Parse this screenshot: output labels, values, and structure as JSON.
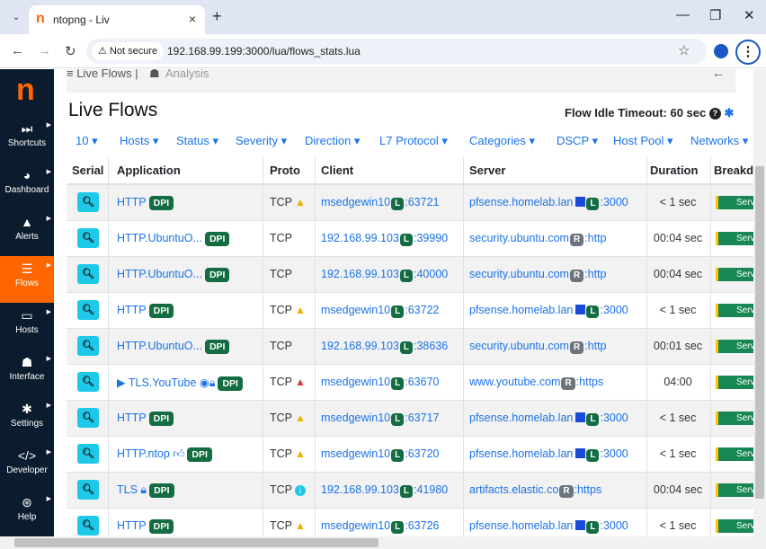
{
  "browser": {
    "tab_title": "ntopng - Liv",
    "tab_close": "×",
    "new_tab": "+",
    "not_secure": "Not secure",
    "url": "192.168.99.199:3000/lua/flows_stats.lua",
    "win_minimize": "—",
    "win_restore": "❐",
    "win_close": "✕"
  },
  "sidebar": {
    "logo": "n",
    "items": [
      {
        "label": "Shortcuts",
        "icon": "fast-forward-icon",
        "glyph": "⏭"
      },
      {
        "label": "Dashboard",
        "icon": "gauge-icon",
        "glyph": "◕"
      },
      {
        "label": "Alerts",
        "icon": "warning-icon",
        "glyph": "▲"
      },
      {
        "label": "Flows",
        "icon": "stream-icon",
        "glyph": "☰",
        "active": true
      },
      {
        "label": "Hosts",
        "icon": "laptop-icon",
        "glyph": "▭"
      },
      {
        "label": "Interface",
        "icon": "ethernet-icon",
        "glyph": "☗"
      },
      {
        "label": "Settings",
        "icon": "cog-icon",
        "glyph": "✱"
      },
      {
        "label": "Developer",
        "icon": "code-icon",
        "glyph": "</>"
      },
      {
        "label": "Help",
        "icon": "life-ring-icon",
        "glyph": "⊛"
      }
    ]
  },
  "topnav": {
    "live_flows": "≡ Live Flows |",
    "analysis": "Analysis",
    "back": "←"
  },
  "page": {
    "title": "Live Flows",
    "idle_timeout": "Flow Idle Timeout: 60 sec"
  },
  "filters": [
    "10 ▾",
    "Hosts ▾",
    "Status ▾",
    "Severity ▾",
    "Direction ▾",
    "L7 Protocol ▾",
    "Categories ▾",
    "DSCP ▾",
    "Host Pool ▾",
    "Networks ▾"
  ],
  "table": {
    "headers": [
      "Serial",
      "Application",
      "Proto",
      "Client",
      "Server",
      "Duration",
      "Breakd"
    ],
    "dpi_label": "DPI",
    "breakdown_label": "Serve",
    "rows": [
      {
        "app": "HTTP",
        "proto": "TCP",
        "proto_icon": "warning",
        "client_host": "msedgewin10",
        "client_port": ":63721",
        "server_host": "pfsense.homelab.lan",
        "server_badge": "L",
        "server_flag": true,
        "server_port": ":3000",
        "duration": "< 1 sec"
      },
      {
        "app": "HTTP.UbuntuO...",
        "proto": "TCP",
        "proto_icon": "",
        "client_host": "192.168.99.103",
        "client_port": ":39990",
        "server_host": "security.ubuntu.com",
        "server_badge": "R",
        "server_flag": false,
        "server_port": ":http",
        "duration": "00:04 sec"
      },
      {
        "app": "HTTP.UbuntuO...",
        "proto": "TCP",
        "proto_icon": "",
        "client_host": "192.168.99.103",
        "client_port": ":40000",
        "server_host": "security.ubuntu.com",
        "server_badge": "R",
        "server_flag": false,
        "server_port": ":http",
        "duration": "00:04 sec"
      },
      {
        "app": "HTTP",
        "proto": "TCP",
        "proto_icon": "warning",
        "client_host": "msedgewin10",
        "client_port": ":63722",
        "server_host": "pfsense.homelab.lan",
        "server_badge": "L",
        "server_flag": true,
        "server_port": ":3000",
        "duration": "< 1 sec"
      },
      {
        "app": "HTTP.UbuntuO...",
        "proto": "TCP",
        "proto_icon": "",
        "client_host": "192.168.99.103",
        "client_port": ":38636",
        "server_host": "security.ubuntu.com",
        "server_badge": "R",
        "server_flag": false,
        "server_port": ":http",
        "duration": "00:01 sec"
      },
      {
        "app": "TLS.YouTube",
        "proto": "TCP",
        "proto_icon": "danger",
        "client_host": "msedgewin10",
        "client_port": ":63670",
        "server_host": "www.youtube.com",
        "server_badge": "R",
        "server_flag": false,
        "server_port": ":https",
        "duration": "04:00"
      },
      {
        "app": "HTTP",
        "proto": "TCP",
        "proto_icon": "warning",
        "client_host": "msedgewin10",
        "client_port": ":63717",
        "server_host": "pfsense.homelab.lan",
        "server_badge": "L",
        "server_flag": true,
        "server_port": ":3000",
        "duration": "< 1 sec"
      },
      {
        "app": "HTTP.ntop",
        "proto": "TCP",
        "proto_icon": "warning",
        "client_host": "msedgewin10",
        "client_port": ":63720",
        "server_host": "pfsense.homelab.lan",
        "server_badge": "L",
        "server_flag": true,
        "server_port": ":3000",
        "duration": "< 1 sec"
      },
      {
        "app": "TLS",
        "proto": "TCP",
        "proto_icon": "info",
        "client_host": "192.168.99.103",
        "client_port": ":41980",
        "server_host": "artifacts.elastic.co",
        "server_badge": "R",
        "server_flag": false,
        "server_port": ":https",
        "duration": "00:04 sec"
      },
      {
        "app": "HTTP",
        "proto": "TCP",
        "proto_icon": "warning",
        "client_host": "msedgewin10",
        "client_port": ":63726",
        "server_host": "pfsense.homelab.lan",
        "server_badge": "L",
        "server_flag": true,
        "server_port": ":3000",
        "duration": "< 1 sec"
      }
    ]
  },
  "colors": {
    "accent": "#ff6600",
    "sidebar": "#0b1c2e",
    "link": "#1a73e8",
    "dpi": "#146c43",
    "zoom_button": "#1ec8e8"
  }
}
